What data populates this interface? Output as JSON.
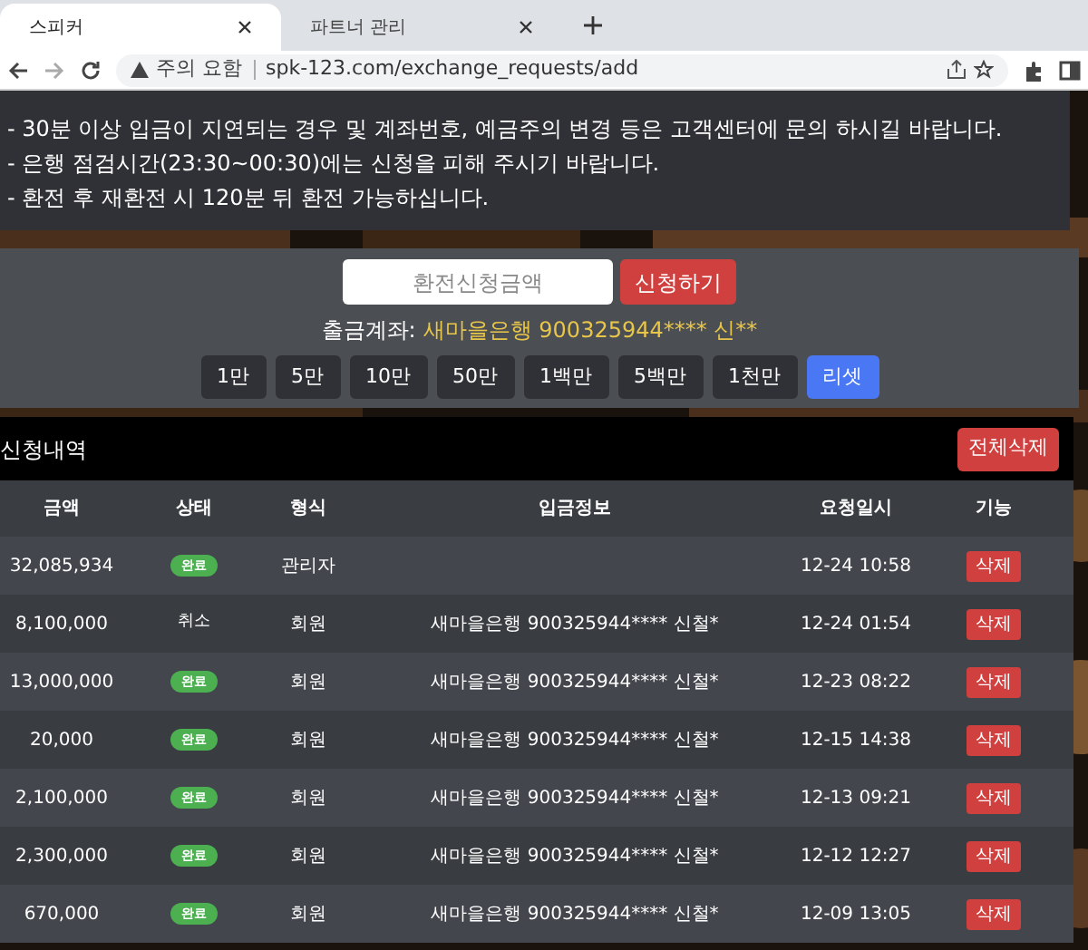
{
  "browser": {
    "tabs": [
      {
        "label": "스피커",
        "selected": true
      },
      {
        "label": "파트너 관리",
        "selected": false
      }
    ],
    "security_label": "주의 요함",
    "url": "spk-123.com/exchange_requests/add"
  },
  "notice": [
    "- 30분 이상 입금이 지연되는 경우 및 계좌번호, 예금주의 변경 등은 고객센터에 문의 하시길 바랍니다.",
    "- 은행 점검시간(23:30~00:30)에는 신청을 피해 주시기 바랍니다.",
    "- 환전 후 재환전 시 120분 뒤 환전 가능하십니다."
  ],
  "form": {
    "amount_placeholder": "환전신청금액",
    "submit": "신청하기",
    "account_label": "출금계좌:",
    "account_value": "새마을은행 900325944**** 신**",
    "quick_amounts": [
      {
        "label": "1만",
        "kind": "amount"
      },
      {
        "label": "5만",
        "kind": "amount"
      },
      {
        "label": "10만",
        "kind": "amount"
      },
      {
        "label": "50만",
        "kind": "amount"
      },
      {
        "label": "1백만",
        "kind": "amount"
      },
      {
        "label": "5백만",
        "kind": "amount"
      },
      {
        "label": "1천만",
        "kind": "amount"
      },
      {
        "label": "리셋",
        "kind": "reset"
      }
    ]
  },
  "history": {
    "title": "신청내역",
    "delete_all": "전체삭제",
    "columns": [
      "금액",
      "상태",
      "형식",
      "입금정보",
      "요청일시",
      "기능"
    ],
    "rows": [
      {
        "amount": "32,085,934",
        "status": {
          "text": "완료",
          "kind": "badge"
        },
        "type": "관리자",
        "deposit": "",
        "time": "12-24 10:58",
        "action": "삭제"
      },
      {
        "amount": "8,100,000",
        "status": {
          "text": "취소",
          "kind": "plain"
        },
        "type": "회원",
        "deposit": "새마을은행 900325944**** 신철*",
        "time": "12-24 01:54",
        "action": "삭제"
      },
      {
        "amount": "13,000,000",
        "status": {
          "text": "완료",
          "kind": "badge"
        },
        "type": "회원",
        "deposit": "새마을은행 900325944**** 신철*",
        "time": "12-23 08:22",
        "action": "삭제"
      },
      {
        "amount": "20,000",
        "status": {
          "text": "완료",
          "kind": "badge"
        },
        "type": "회원",
        "deposit": "새마을은행 900325944**** 신철*",
        "time": "12-15 14:38",
        "action": "삭제"
      },
      {
        "amount": "2,100,000",
        "status": {
          "text": "완료",
          "kind": "badge"
        },
        "type": "회원",
        "deposit": "새마을은행 900325944**** 신철*",
        "time": "12-13 09:21",
        "action": "삭제"
      },
      {
        "amount": "2,300,000",
        "status": {
          "text": "완료",
          "kind": "badge"
        },
        "type": "회원",
        "deposit": "새마을은행 900325944**** 신철*",
        "time": "12-12 12:27",
        "action": "삭제"
      },
      {
        "amount": "670,000",
        "status": {
          "text": "완료",
          "kind": "badge"
        },
        "type": "회원",
        "deposit": "새마을은행 900325944**** 신철*",
        "time": "12-09 13:05",
        "action": "삭제"
      }
    ]
  }
}
